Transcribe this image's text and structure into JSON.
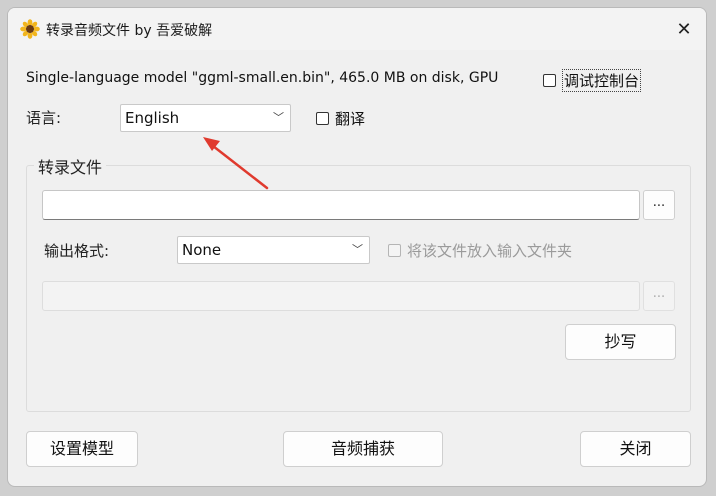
{
  "window": {
    "title": "转录音频文件 by 吾爱破解",
    "close_glyph": "✕"
  },
  "model_info": "Single-language model \"ggml-small.en.bin\", 465.0 MB on disk, GPU",
  "debug_console": {
    "label": "调试控制台",
    "checked": false
  },
  "language": {
    "label": "语言:",
    "selected": "English"
  },
  "translate": {
    "label": "翻译",
    "checked": false
  },
  "transcribe_group": {
    "title": "转录文件",
    "input_file": {
      "value": "",
      "browse_label": "..."
    },
    "output_format": {
      "label": "输出格式:",
      "selected": "None"
    },
    "same_folder": {
      "label": "将该文件放入输入文件夹",
      "checked": false,
      "disabled": true
    },
    "output_file": {
      "value": "",
      "browse_label": "..."
    },
    "transcribe_button": "抄写"
  },
  "footer": {
    "setup_model": "设置模型",
    "audio_capture": "音频捕获",
    "close": "关闭"
  },
  "colors": {
    "annotation_arrow": "#e03a2e"
  }
}
